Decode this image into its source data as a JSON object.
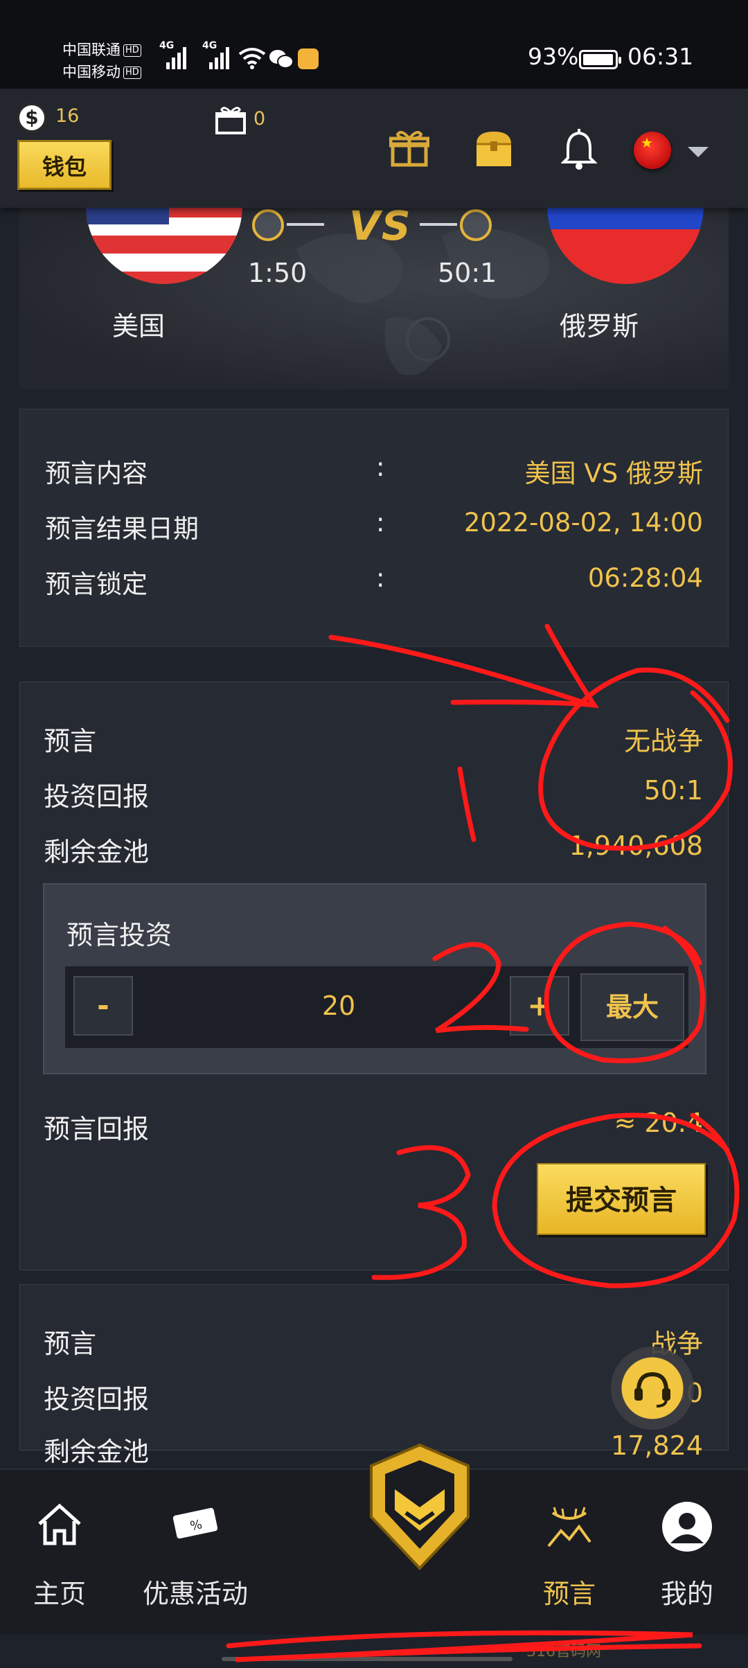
{
  "status_bar": {
    "carrier1": "中国联通",
    "carrier2": "中国移动",
    "hd": "HD",
    "net1": "4G",
    "net2": "4G",
    "battery": "93%",
    "battery_level": 0.93,
    "time": "06:31"
  },
  "header": {
    "coin_count": "16",
    "gift_count": "0",
    "wallet_label": "钱包",
    "language_flag": "china-flag-icon"
  },
  "match": {
    "team_a": "美国",
    "team_b": "俄罗斯",
    "odds_a": "1:50",
    "odds_b": "50:1",
    "vs": "VS"
  },
  "info": {
    "rows": [
      {
        "label": "预言内容",
        "colon": ":",
        "value": "美国 VS 俄罗斯"
      },
      {
        "label": "预言结果日期",
        "colon": ":",
        "value": "2022-08-02, 14:00"
      },
      {
        "label": "预言锁定",
        "colon": ":",
        "value": "06:28:04"
      }
    ]
  },
  "card1": {
    "prediction_label": "预言",
    "prediction_value": "无战争",
    "return_label": "投资回报",
    "return_value": "50:1",
    "pool_label": "剩余金池",
    "pool_value": "1,940,608",
    "invest_title": "预言投资",
    "minus": "-",
    "amount": "20",
    "plus": "+",
    "max_label": "最大",
    "reward_label": "预言回报",
    "reward_value": "≈ 20.4",
    "submit_label": "提交预言"
  },
  "card2": {
    "prediction_label": "预言",
    "prediction_value": "战争",
    "return_label": "投资回报",
    "return_value": "1:50",
    "pool_label": "剩余金池",
    "pool_value": "17,824"
  },
  "nav": {
    "items": [
      {
        "label": "主页",
        "icon": "home-icon"
      },
      {
        "label": "优惠活动",
        "icon": "ticket-icon"
      },
      {
        "label": "预言",
        "icon": "prophecy-icon"
      },
      {
        "label": "我的",
        "icon": "user-icon"
      }
    ]
  },
  "annotations": [
    "1",
    "2",
    "3"
  ],
  "watermark": "316官码网",
  "colors": {
    "accent": "#f0c34d",
    "background": "#1e222b",
    "annotation": "#ff1a1a"
  }
}
